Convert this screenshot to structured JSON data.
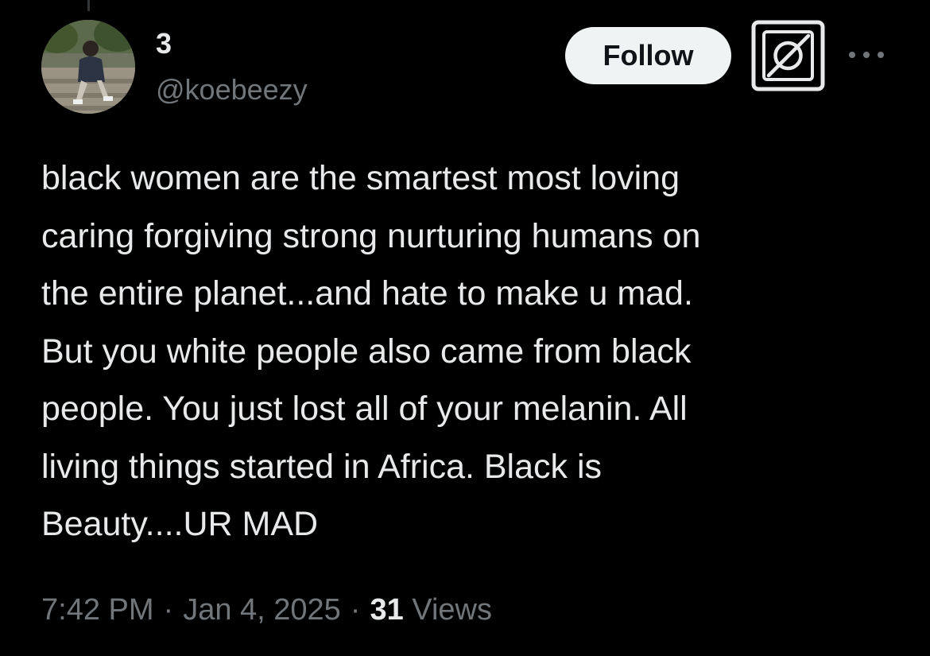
{
  "user": {
    "display_name": "3",
    "handle": "@koebeezy",
    "avatar_icon": "user-avatar-photo"
  },
  "actions": {
    "follow_label": "Follow",
    "grok_icon": "grok-icon",
    "more_icon": "more-options-icon"
  },
  "tweet": {
    "lines": [
      "black women are the smartest most loving",
      "caring forgiving strong nurturing humans on",
      "the entire planet...and hate to make u mad.",
      "But you white people also came from black",
      "people. You just lost all of your melanin. All",
      "living things started in Africa. Black is",
      "Beauty....UR MAD"
    ]
  },
  "meta": {
    "time": "7:42 PM",
    "separator": "·",
    "date": "Jan 4, 2025",
    "views_count": "31",
    "views_label": "Views"
  },
  "colors": {
    "background": "#000000",
    "primary_text": "#e7e9ea",
    "secondary_text": "#71767b",
    "follow_button_bg": "#eff3f4",
    "follow_button_text": "#0f1419"
  }
}
